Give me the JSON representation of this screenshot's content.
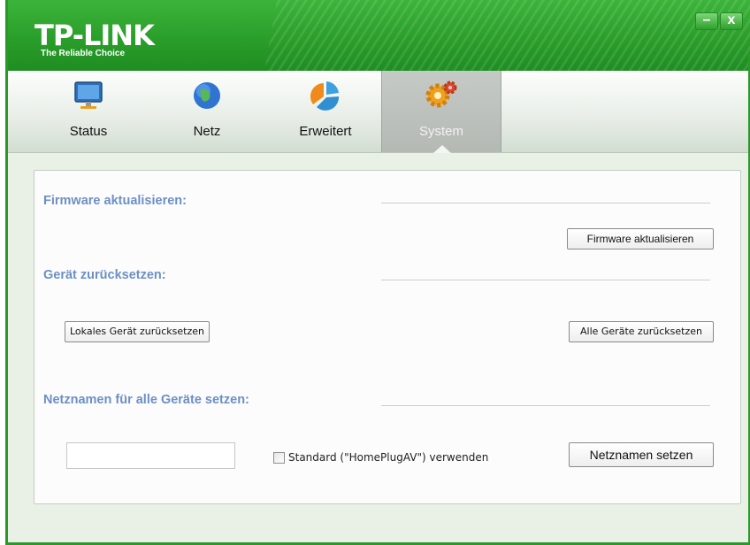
{
  "header": {
    "logo": "TP-LINK",
    "slogan": "The Reliable Choice",
    "minimize_glyph": "–",
    "close_glyph": "x"
  },
  "tabs": [
    {
      "label": "Status",
      "icon": "monitor-icon"
    },
    {
      "label": "Netz",
      "icon": "globe-icon"
    },
    {
      "label": "Erweitert",
      "icon": "pie-chart-icon"
    },
    {
      "label": "System",
      "icon": "gears-icon",
      "active": true
    }
  ],
  "firmware": {
    "title": "Firmware aktualisieren:",
    "button": "Firmware aktualisieren"
  },
  "reset": {
    "title": "Gerät zurücksetzen:",
    "local_button": "Lokales Gerät zurücksetzen",
    "all_button": "Alle Geräte zurücksetzen"
  },
  "netname": {
    "title": "Netznamen für alle Geräte setzen:",
    "input_value": "",
    "checkbox_label": "Standard (\"HomePlugAV\") verwenden",
    "checkbox_checked": false,
    "button": "Netznamen setzen"
  },
  "colors": {
    "brand_green": "#2a9e2a",
    "section_title": "#6d8fc6"
  }
}
